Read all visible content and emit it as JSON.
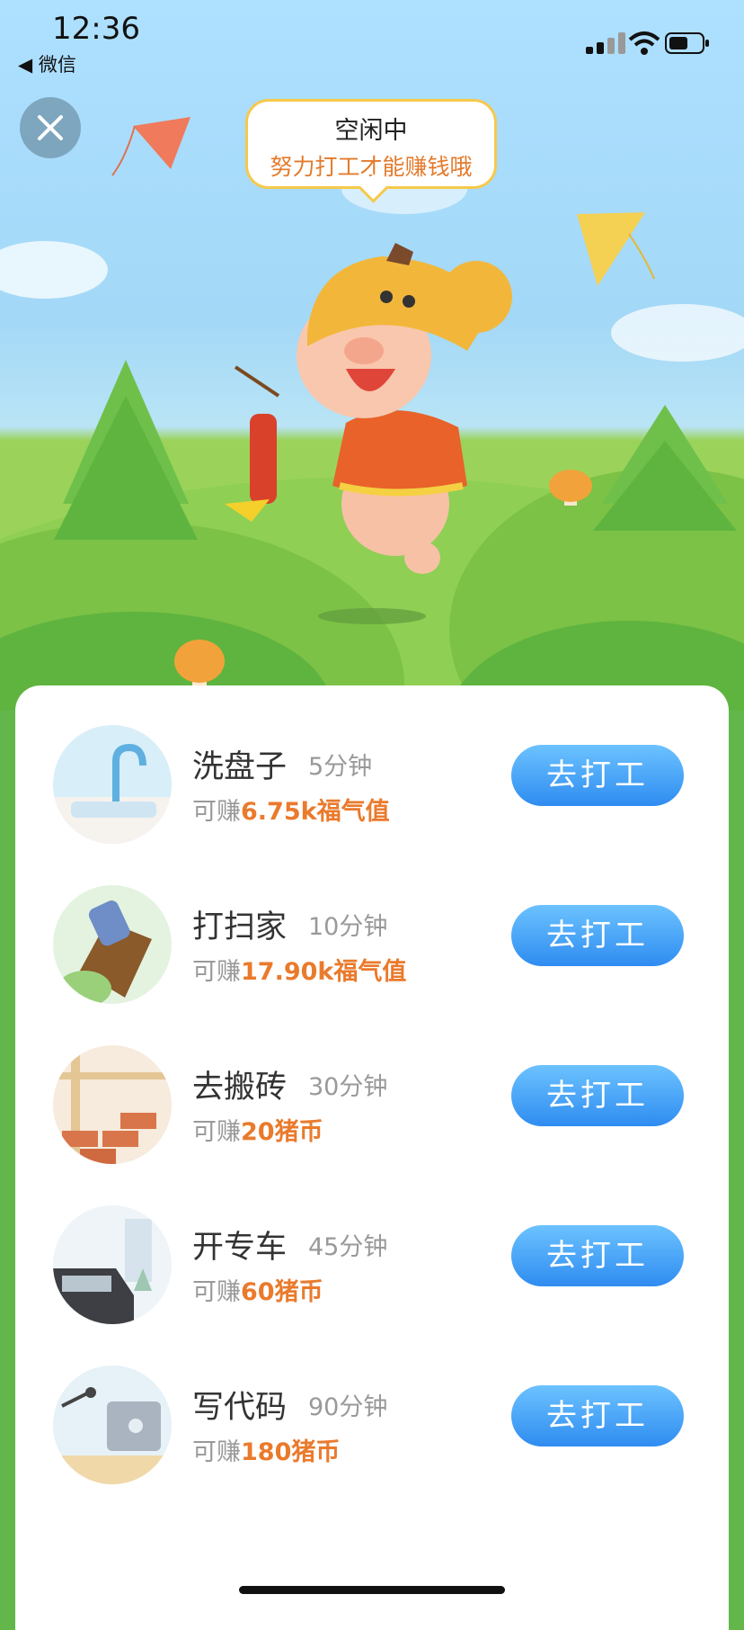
{
  "status_bar": {
    "time": "12:36",
    "back_label": "◀ 微信"
  },
  "bubble": {
    "status": "空闲中",
    "tip": "努力打工才能赚钱哦"
  },
  "jobs": [
    {
      "name": "洗盘子",
      "duration": "5分钟",
      "reward_prefix": "可赚",
      "reward_amount": "6.75k福气值",
      "button": "去打工",
      "icon": "sink-icon"
    },
    {
      "name": "打扫家",
      "duration": "10分钟",
      "reward_prefix": "可赚",
      "reward_amount": "17.90k福气值",
      "button": "去打工",
      "icon": "broom-icon"
    },
    {
      "name": "去搬砖",
      "duration": "30分钟",
      "reward_prefix": "可赚",
      "reward_amount": "20猪币",
      "button": "去打工",
      "icon": "bricks-icon"
    },
    {
      "name": "开专车",
      "duration": "45分钟",
      "reward_prefix": "可赚",
      "reward_amount": "60猪币",
      "button": "去打工",
      "icon": "car-icon"
    },
    {
      "name": "写代码",
      "duration": "90分钟",
      "reward_prefix": "可赚",
      "reward_amount": "180猪币",
      "button": "去打工",
      "icon": "laptop-icon"
    }
  ],
  "colors": {
    "accent_orange": "#ea7a2c",
    "button_blue": "#3a95f2",
    "grass_green": "#62b64a",
    "sky_blue": "#a9dcf8"
  }
}
